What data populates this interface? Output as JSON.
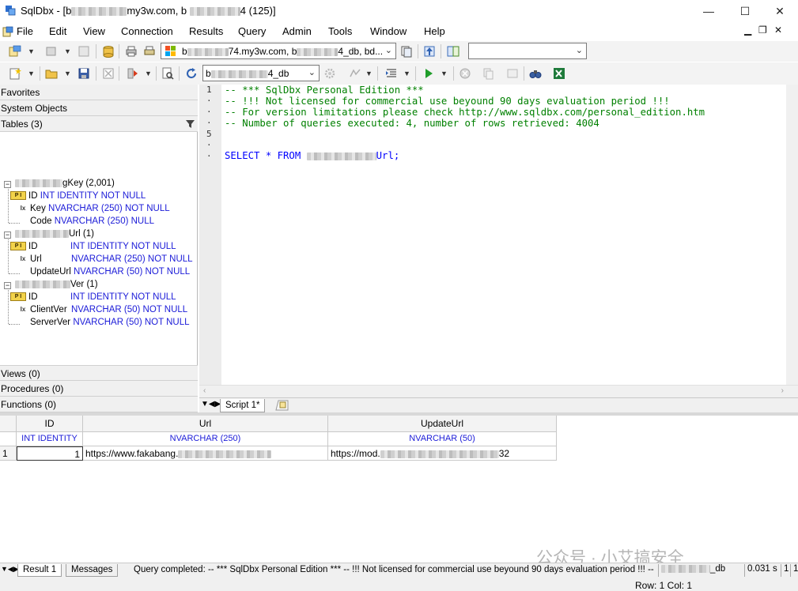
{
  "window": {
    "title_prefix": "SqlDbx - [b",
    "title_suffix": "my3w.com, b",
    "title_end": "4 (125)]",
    "minimize": "—",
    "maximize": "☐",
    "close": "✕"
  },
  "menu": {
    "items": [
      "File",
      "Edit",
      "View",
      "Connection",
      "Results",
      "Query",
      "Admin",
      "Tools",
      "Window",
      "Help"
    ],
    "mdi_min": "▁",
    "mdi_restore": "❐",
    "mdi_close": "✕"
  },
  "toolbar1": {
    "connection_combo": {
      "prefix": "b",
      "mid": "74.my3w.com, b",
      "end": "4_db, bd..."
    },
    "right_combo": ""
  },
  "toolbar2": {
    "database_combo": {
      "prefix": "b",
      "end": "4_db"
    }
  },
  "left_panel": {
    "favorites": "Favorites",
    "system_objects": "System Objects",
    "tables_label": "Tables  (3)",
    "views_label": "Views  (0)",
    "procedures_label": "Procedures  (0)",
    "functions_label": "Functions  (0)",
    "tables": [
      {
        "name_suffix": "gKey",
        "count": "(2,001)",
        "columns": [
          {
            "name": "ID",
            "type": "INT IDENTITY NOT NULL",
            "key": "pk"
          },
          {
            "name": "Key",
            "type": "NVARCHAR (250) NOT NULL",
            "key": "ix"
          },
          {
            "name": "Code",
            "type": "NVARCHAR (250) NULL",
            "key": "none"
          }
        ]
      },
      {
        "name_suffix": "Url",
        "count": "(1)",
        "columns": [
          {
            "name": "ID",
            "type": "INT IDENTITY NOT NULL",
            "key": "pk"
          },
          {
            "name": "Url",
            "type": "NVARCHAR (250) NOT NULL",
            "key": "ix"
          },
          {
            "name": "UpdateUrl",
            "type": "NVARCHAR (50) NOT NULL",
            "key": "none"
          }
        ]
      },
      {
        "name_suffix": "Ver",
        "count": "(1)",
        "columns": [
          {
            "name": "ID",
            "type": "INT IDENTITY NOT NULL",
            "key": "pk"
          },
          {
            "name": "ClientVer",
            "type": "NVARCHAR (50) NOT NULL",
            "key": "ix"
          },
          {
            "name": "ServerVer",
            "type": "NVARCHAR (50) NOT NULL",
            "key": "none"
          }
        ]
      }
    ]
  },
  "editor": {
    "gutter": [
      "1",
      "·",
      "·",
      "·",
      "5",
      "·",
      "·"
    ],
    "lines": [
      "-- *** SqlDbx Personal Edition ***",
      "-- !!! Not licensed for commercial use beyound 90 days evaluation period !!!",
      "-- For version limitations please check http://www.sqldbx.com/personal_edition.htm",
      "-- Number of queries executed: 4, number of rows retrieved: 4004"
    ],
    "select_keyword": "SELECT * FROM",
    "select_table_suffix": "Url;",
    "tab_label": "Script 1*"
  },
  "results": {
    "columns": [
      {
        "name": "ID",
        "type": "INT IDENTITY"
      },
      {
        "name": "Url",
        "type": "NVARCHAR (250)"
      },
      {
        "name": "UpdateUrl",
        "type": "NVARCHAR (50)"
      }
    ],
    "rows": [
      {
        "row_num": "1",
        "id": "1",
        "url_prefix": "https://www.fakabang.",
        "update_prefix": "https://mod.",
        "update_end": "32"
      }
    ]
  },
  "bottom": {
    "tab_result": "Result 1",
    "tab_messages": "Messages",
    "query_status": "Query completed: -- *** SqlDbx Personal Edition ***  -- !!! Not licensed for commercial use beyound 90 days evaluation period !!!  -- F...",
    "db_suffix": "_db",
    "elapsed": "0.031 s",
    "page_a": "1",
    "page_b": "1",
    "row_col": "Row: 1  Col: 1"
  },
  "watermark": "公众号 · 小艾搞安全"
}
